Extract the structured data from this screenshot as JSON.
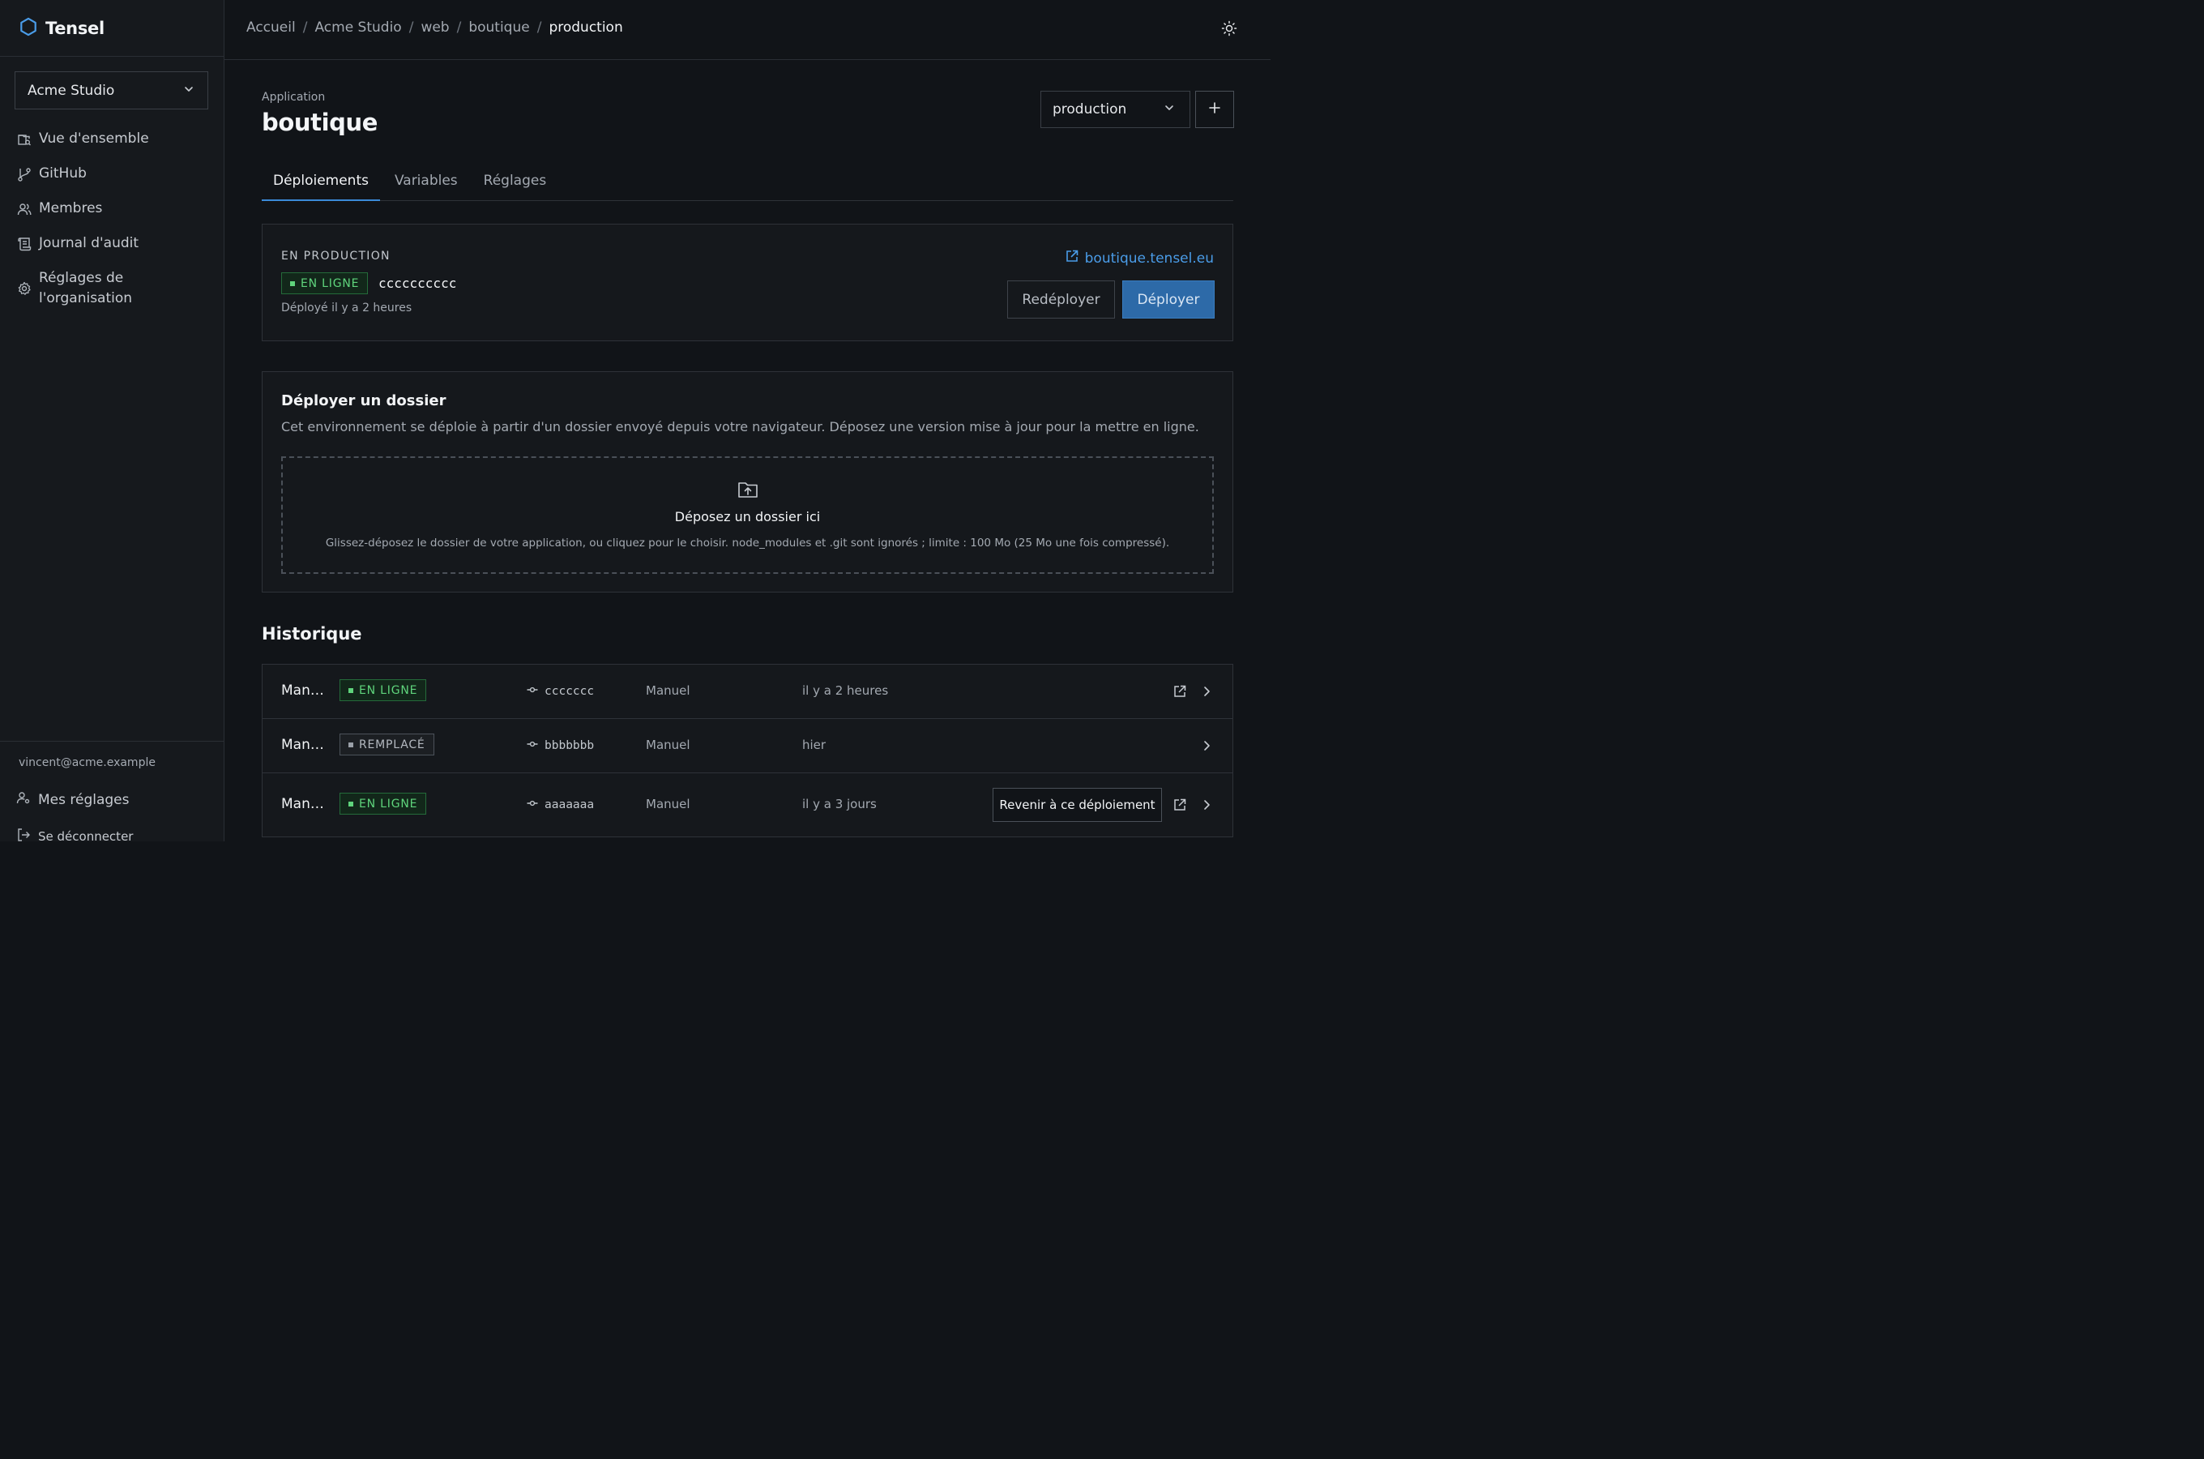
{
  "brand": {
    "name": "Tensel"
  },
  "sidebar": {
    "org": "Acme Studio",
    "items": [
      {
        "label": "Vue d'ensemble",
        "icon": "overview-icon"
      },
      {
        "label": "GitHub",
        "icon": "git-branch-icon"
      },
      {
        "label": "Membres",
        "icon": "members-icon"
      },
      {
        "label": "Journal d'audit",
        "icon": "audit-log-icon"
      },
      {
        "label": "Réglages de l'organisation",
        "icon": "gear-icon"
      }
    ],
    "user_email": "vincent@acme.example",
    "my_settings": "Mes réglages",
    "logout": "Se déconnecter"
  },
  "breadcrumb": {
    "items": [
      "Accueil",
      "Acme Studio",
      "web",
      "boutique"
    ],
    "current": "production",
    "separator": "/"
  },
  "app": {
    "kicker": "Application",
    "title": "boutique",
    "environment": "production"
  },
  "tabs": [
    "Déploiements",
    "Variables",
    "Réglages"
  ],
  "production": {
    "label": "EN PRODUCTION",
    "status": "EN LIGNE",
    "sha": "cccccccccc",
    "deployed": "Déployé il y a 2 heures",
    "url": "boutique.tensel.eu",
    "redeploy": "Redéployer",
    "deploy": "Déployer"
  },
  "folder": {
    "title": "Déployer un dossier",
    "description": "Cet environnement se déploie à partir d'un dossier envoyé depuis votre navigateur. Déposez une version mise à jour pour la mettre en ligne.",
    "drop_title": "Déposez un dossier ici",
    "drop_hint": "Glissez-déposez le dossier de votre application, ou cliquez pour le choisir. node_modules et .git sont ignorés ; limite : 100 Mo (25 Mo une fois compressé)."
  },
  "history": {
    "title": "Historique",
    "rollback_label": "Revenir à ce déploiement",
    "rows": [
      {
        "name": "Man…",
        "status": "EN LIGNE",
        "status_kind": "live",
        "sha": "ccccccc",
        "trigger": "Manuel",
        "when": "il y a 2 heures"
      },
      {
        "name": "Man…",
        "status": "REMPLACÉ",
        "status_kind": "replaced",
        "sha": "bbbbbbb",
        "trigger": "Manuel",
        "when": "hier"
      },
      {
        "name": "Man…",
        "status": "EN LIGNE",
        "status_kind": "live",
        "sha": "aaaaaaa",
        "trigger": "Manuel",
        "when": "il y a 3 jours"
      }
    ]
  },
  "colors": {
    "accent": "#3b8ad8",
    "link": "#4a9ce8",
    "live": "#5fd47c",
    "primary_button": "#2d6aa8"
  }
}
